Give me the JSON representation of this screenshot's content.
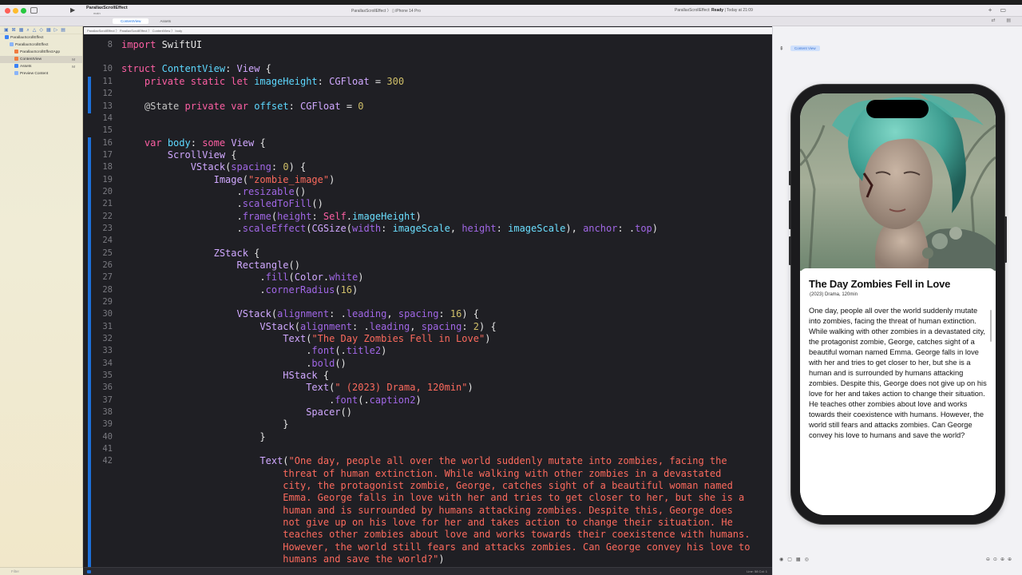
{
  "titlebar": {
    "project_name": "ParallaxScrollEffect",
    "project_branch": "main",
    "scheme_target": "ParallaxScrollEffect",
    "scheme_device": "iPhone 14 Pro",
    "status_prefix": "ParallaxScrollEffect: ",
    "status_state": "Ready",
    "status_time": " | Today at 21:09"
  },
  "tabs": [
    {
      "label": "ContentView",
      "active": true
    },
    {
      "label": "Assets",
      "active": false
    }
  ],
  "jumpbar": {
    "path": "ParallaxScrollEffect 〉 ParallaxScrollEffect 〉 ContentView 〉 body"
  },
  "navigator": {
    "items": [
      {
        "label": "ParallaxScrollEffect",
        "indent": 1,
        "icon": "project-icon",
        "mod": ""
      },
      {
        "label": "ParallaxScrollEffect",
        "indent": 2,
        "icon": "folder-icon",
        "mod": ""
      },
      {
        "label": "ParallaxScrollEffectApp",
        "indent": 3,
        "icon": "swift-file-icon",
        "mod": ""
      },
      {
        "label": "ContentView",
        "indent": 3,
        "icon": "swift-file-icon",
        "mod": "M",
        "selected": true
      },
      {
        "label": "Assets",
        "indent": 3,
        "icon": "asset-catalog-icon",
        "mod": "M"
      },
      {
        "label": "Preview Content",
        "indent": 3,
        "icon": "folder-icon",
        "mod": ""
      }
    ],
    "filter_placeholder": "Filter"
  },
  "editor": {
    "status": "Line: 58  Col: 1"
  },
  "preview": {
    "tag": "Content View",
    "title": "The Day Zombies Fell in Love",
    "meta": " (2023) Drama, 120min",
    "description": "One day, people all over the world suddenly mutate into zombies, facing the threat of human extinction. While walking with other zombies in a devastated city, the protagonist zombie, George, catches sight of a beautiful woman named Emma. George falls in love with her and tries to get closer to her, but she is a human and is surrounded by humans attacking zombies. Despite this, George does not give up on his love for her and takes action to change their situation. He teaches other zombies about love and works towards their coexistence with humans. However, the world still fears and attacks zombies. Can George convey his love to humans and save the world?"
  },
  "colors": {
    "keyword": "#fc5fa3",
    "type": "#d0a8ff",
    "string": "#fc6a5d",
    "number": "#d0bf69",
    "change_bar": "#1d6fd8"
  }
}
